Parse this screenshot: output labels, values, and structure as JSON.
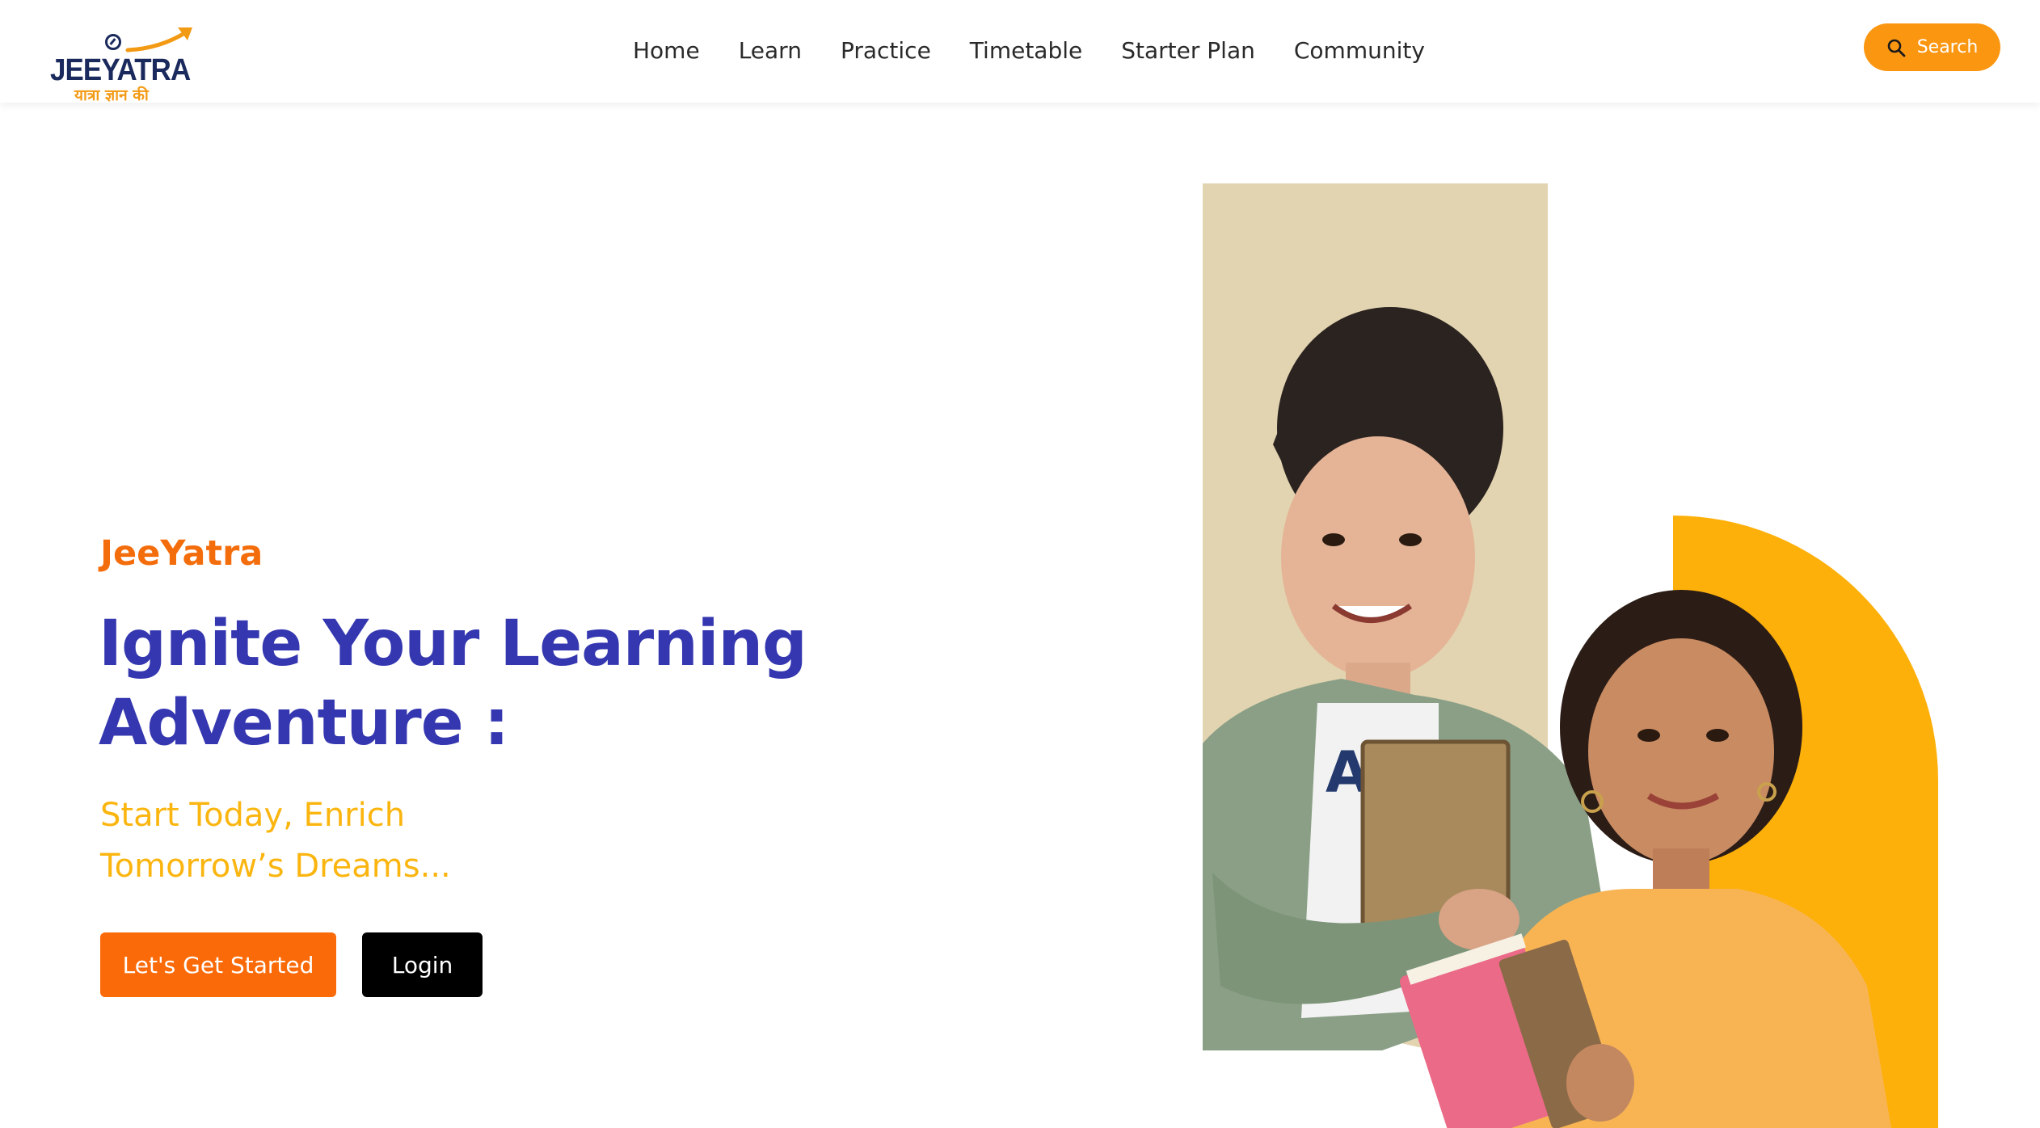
{
  "header": {
    "logo": {
      "wordmark": "JEEYATRA",
      "tagline": "यात्रा ज्ञान की",
      "icon": "compass-arrow-logo"
    },
    "nav": [
      {
        "label": "Home"
      },
      {
        "label": "Learn"
      },
      {
        "label": "Practice"
      },
      {
        "label": "Timetable"
      },
      {
        "label": "Starter Plan"
      },
      {
        "label": "Community"
      }
    ],
    "search": {
      "label": "Search",
      "icon": "search-icon"
    }
  },
  "hero": {
    "eyebrow": "JeeYatra",
    "headline_line1": "Ignite Your Learning",
    "headline_line2": "Adventure :",
    "subhead_line1": "Start Today, Enrich",
    "subhead_line2": "Tomorrow’s Dreams...",
    "primary_button": "Let's Get Started",
    "secondary_button": "Login",
    "image": "two-students-holding-books"
  },
  "colors": {
    "brand_navy": "#1b2a5c",
    "accent_orange": "#fb6a08",
    "search_orange": "#fb9611",
    "headline_blue": "#3537b0",
    "subhead_yellow": "#fbb50f",
    "panel_beige": "#e2d4b0",
    "arch_yellow": "#fdb00a"
  }
}
